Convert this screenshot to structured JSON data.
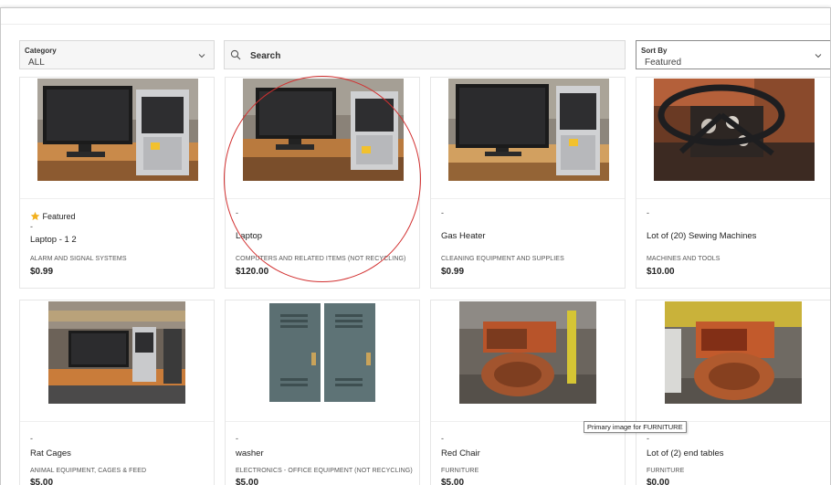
{
  "filters": {
    "category_label": "Category",
    "category_value": "ALL",
    "search_placeholder": "Search",
    "sort_label": "Sort By",
    "sort_value": "Featured"
  },
  "featured_label": "Featured",
  "tooltip": "Primary image for FURNITURE",
  "colors": {
    "annotation_circle": "#d23030",
    "star": "#f2b01e"
  },
  "items": [
    {
      "dash": "-",
      "title": "Laptop - 1 2",
      "category": "ALARM AND SIGNAL SYSTEMS",
      "price": "$0.99",
      "featured": true,
      "image": "computer-monitor-tower"
    },
    {
      "dash": "-",
      "title": "Laptop",
      "category": "COMPUTERS AND RELATED ITEMS (NOT RECYCLING)",
      "price": "$120.00",
      "featured": false,
      "image": "computer-monitor-tower"
    },
    {
      "dash": "-",
      "title": "Gas Heater",
      "category": "CLEANING EQUIPMENT AND SUPPLIES",
      "price": "$0.99",
      "featured": false,
      "image": "computer-monitor-tower"
    },
    {
      "dash": "-",
      "title": "Lot of (20) Sewing Machines",
      "category": "MACHINES AND TOOLS",
      "price": "$10.00",
      "featured": false,
      "image": "machine-steering-wheel"
    },
    {
      "dash": "-",
      "title": "Rat Cages",
      "category": "ANIMAL EQUIPMENT, CAGES & FEED",
      "price": "$5.00",
      "featured": false,
      "image": "computer-on-desk"
    },
    {
      "dash": "-",
      "title": "washer",
      "category": "ELECTRONICS - OFFICE EQUIPMENT (NOT RECYCLING)",
      "price": "$5.00",
      "featured": false,
      "image": "metal-lockers"
    },
    {
      "dash": "-",
      "title": "Red Chair",
      "category": "FURNITURE",
      "price": "$5.00",
      "featured": false,
      "image": "rusty-compactor"
    },
    {
      "dash": "-",
      "title": "Lot of (2) end tables",
      "category": "FURNITURE",
      "price": "$0.00",
      "featured": false,
      "image": "rusty-compactor"
    }
  ]
}
